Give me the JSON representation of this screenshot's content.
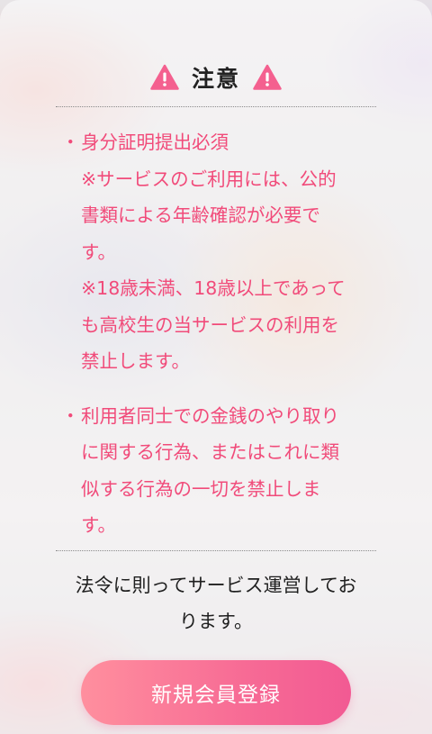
{
  "colors": {
    "accent": "#f14b7a",
    "warning_icon": "#f4608f",
    "button_gradient_start": "#ff8f9e",
    "button_gradient_end": "#f25a93"
  },
  "header": {
    "title": "注意",
    "icon": "warning-triangle-icon"
  },
  "notices": [
    {
      "bullet": "・",
      "lines": [
        "身分証明提出必須",
        "※サービスのご利用には、公的",
        "書類による年齢確認が必要で",
        "す。",
        "※18歳未満、18歳以上であって",
        "も高校生の当サービスの利用を",
        "禁止します。"
      ]
    },
    {
      "bullet": "・",
      "lines": [
        "利用者同士での金銭のやり取り",
        "に関する行為、またはこれに類",
        "似する行為の一切を禁止しま",
        "す。"
      ]
    }
  ],
  "legal": {
    "lines": [
      "法令に則ってサービス運営してお",
      "ります。"
    ]
  },
  "cta": {
    "label": "新規会員登録"
  }
}
